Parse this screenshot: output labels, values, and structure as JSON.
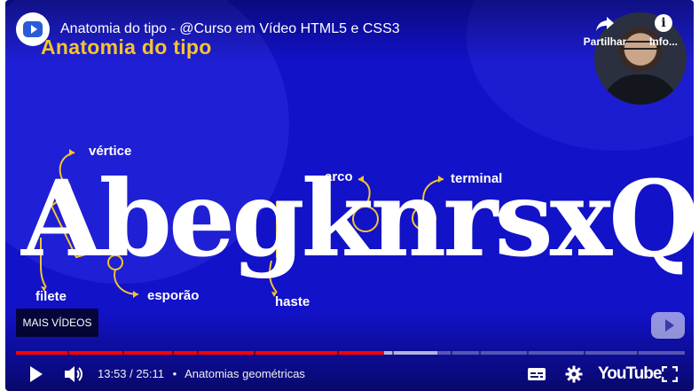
{
  "video": {
    "title": "Anatomia do tipo - @Curso em Vídeo HTML5 e CSS3"
  },
  "slide": {
    "heading": "Anatomia do tipo",
    "letters": "AbegknrsxQ",
    "annotations": {
      "vertice": "vértice",
      "filete": "filete",
      "esporao": "esporão",
      "haste": "haste",
      "arco": "arco",
      "terminal": "terminal"
    },
    "accent_color": "#f4c430",
    "background_color": "#1212c8"
  },
  "top_actions": {
    "share_label": "Partilhar",
    "info_label": "Info..."
  },
  "overlay": {
    "more_videos_label": "MAIS VÍDEOS"
  },
  "player": {
    "current_time": "13:53",
    "duration": "25:11",
    "chapter": "Anatomias geométricas",
    "progress_fraction": 0.551,
    "buffered_fraction": 0.63,
    "brand": "YouTube"
  }
}
